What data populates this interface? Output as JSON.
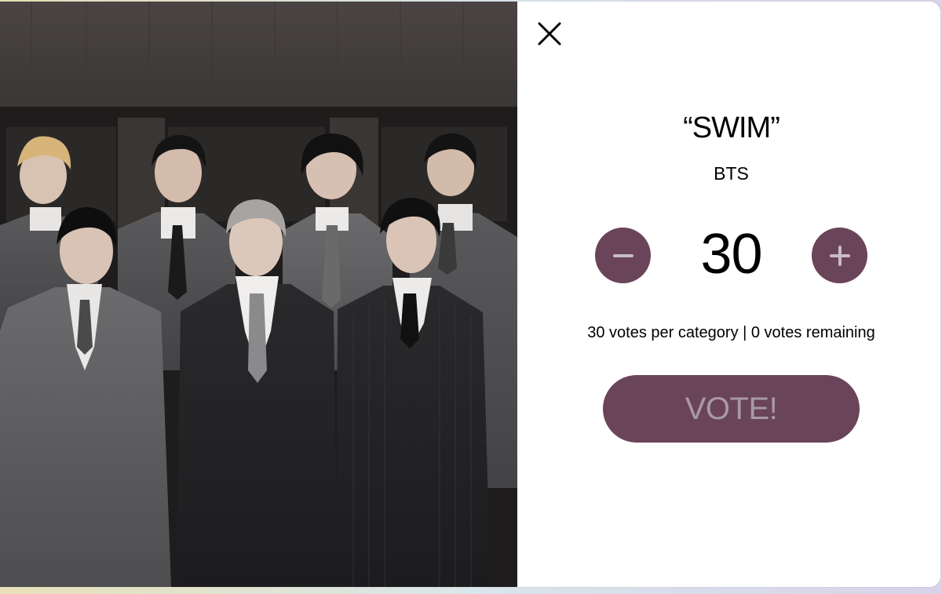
{
  "modal": {
    "image": {
      "description_icon": "group-photo"
    },
    "close_icon": "close-icon",
    "song_title": "“SWIM”",
    "artist": "BTS",
    "stepper": {
      "minus_icon": "minus-icon",
      "plus_icon": "plus-icon",
      "value": "30"
    },
    "vote_info": "30 votes per category | 0 votes remaining",
    "vote_button_label": "VOTE!"
  },
  "colors": {
    "accent": "#6a4459",
    "vote_label": "#a89aa2"
  }
}
